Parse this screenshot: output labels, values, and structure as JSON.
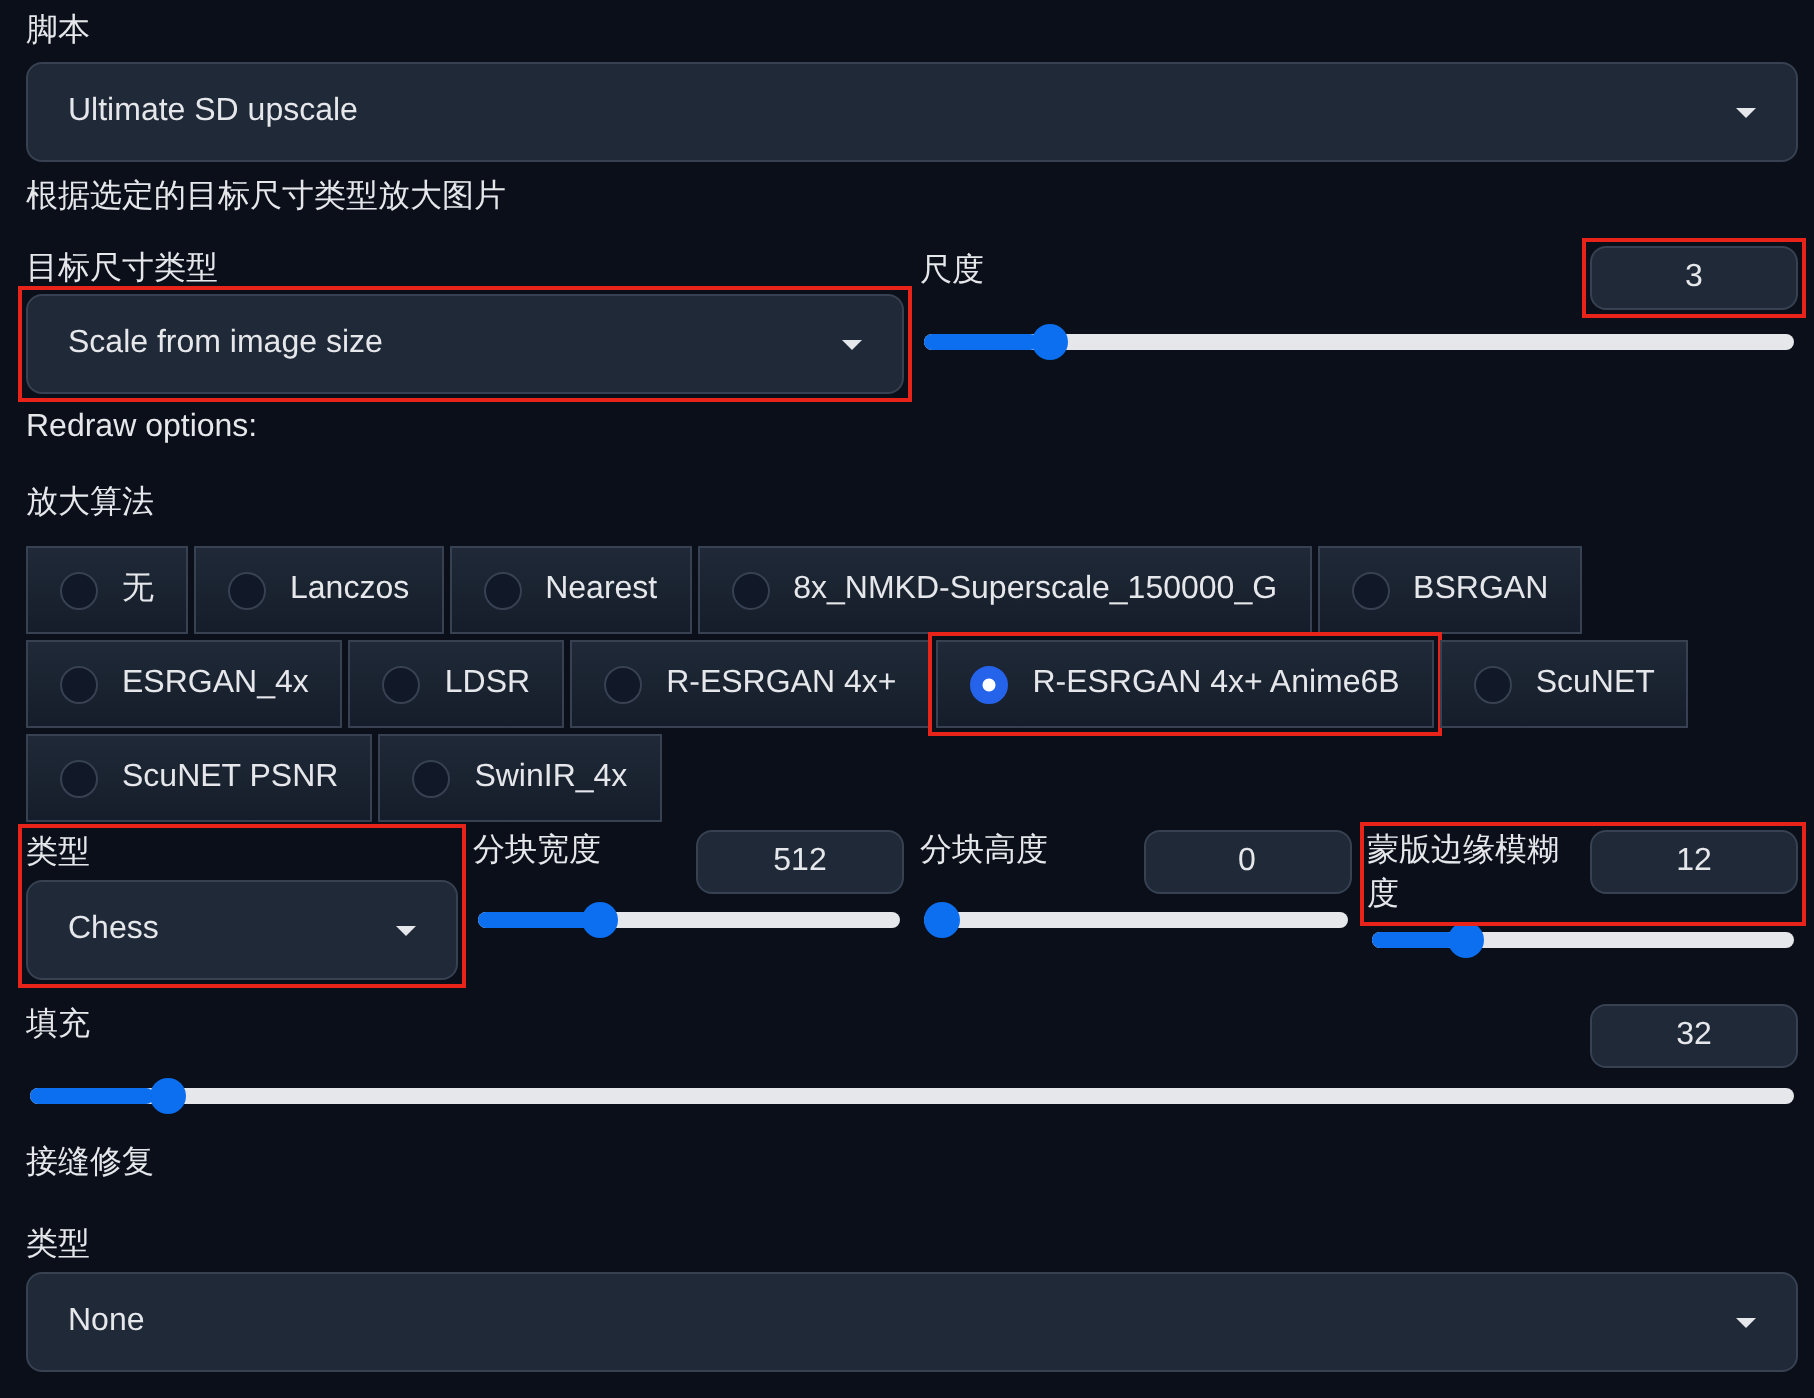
{
  "script": {
    "label": "脚本",
    "value": "Ultimate SD upscale"
  },
  "description": "根据选定的目标尺寸类型放大图片",
  "target_size": {
    "label": "目标尺寸类型",
    "value": "Scale from image size",
    "control_highlighted": true
  },
  "scale": {
    "label": "尺度",
    "value": "3",
    "level": 0.13,
    "control_highlighted": true
  },
  "redraw_label": "Redraw options:",
  "upscaler": {
    "label": "放大算法",
    "options": [
      {
        "label": "无",
        "selected": false
      },
      {
        "label": "Lanczos",
        "selected": false
      },
      {
        "label": "Nearest",
        "selected": false
      },
      {
        "label": "8x_NMKD-Superscale_150000_G",
        "selected": false
      },
      {
        "label": "BSRGAN",
        "selected": false
      },
      {
        "label": "ESRGAN_4x",
        "selected": false
      },
      {
        "label": "LDSR",
        "selected": false
      },
      {
        "label": "R-ESRGAN 4x+",
        "selected": false
      },
      {
        "label": "R-ESRGAN 4x+ Anime6B",
        "selected": true,
        "highlighted": true
      },
      {
        "label": "ScuNET",
        "selected": false
      },
      {
        "label": "ScuNET PSNR",
        "selected": false
      },
      {
        "label": "SwinIR_4x",
        "selected": false
      }
    ]
  },
  "tile_row": [
    {
      "kind": "dropdown",
      "label": "类型",
      "value": "Chess",
      "label_highlighted": true,
      "control_highlighted": true
    },
    {
      "kind": "slider",
      "label": "分块宽度",
      "value": "512",
      "level": 0.27
    },
    {
      "kind": "slider",
      "label": "分块高度",
      "value": "0",
      "level": 0
    },
    {
      "kind": "slider",
      "label": "蒙版边缘模糊度",
      "value": "12",
      "level": 0.2,
      "label_highlighted": true,
      "control_highlighted": true
    }
  ],
  "padding": {
    "label": "填充",
    "value": "32",
    "level": 0.07
  },
  "seams_fix_label": "接缝修复",
  "seams_fix_type": {
    "label": "类型",
    "value": "None"
  }
}
